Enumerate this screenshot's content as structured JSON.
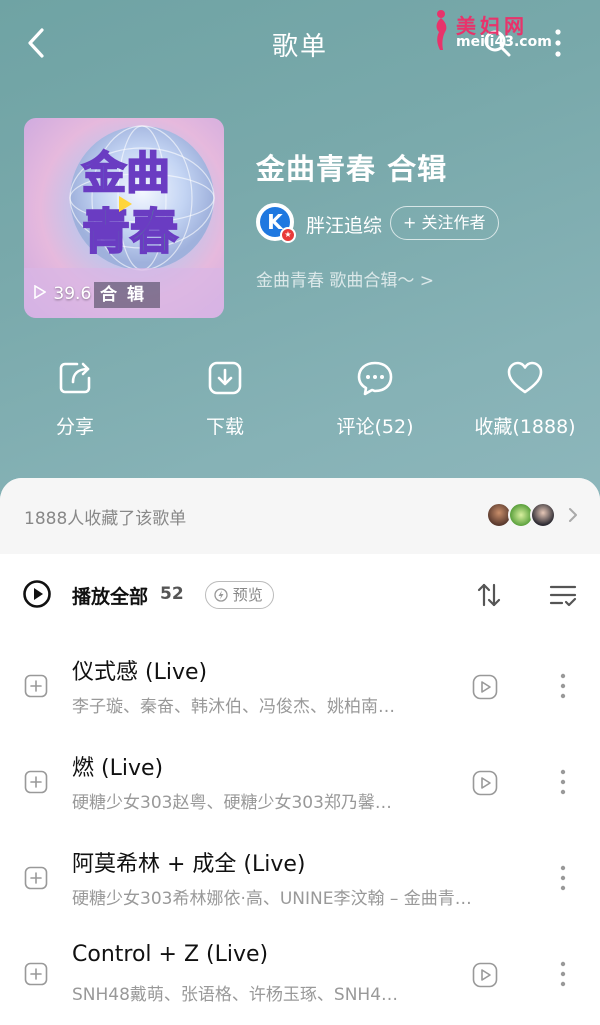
{
  "header": {
    "title": "歌单"
  },
  "watermark": {
    "title": "美妇网",
    "url": "meili43.com"
  },
  "playlist": {
    "cover_play_count": "39.6",
    "cover_tag": "合辑",
    "title": "金曲青春 合辑",
    "creator": "胖汪追综",
    "creator_avatar_letter": "K",
    "follow_label": "+ 关注作者",
    "description": "金曲青春 歌曲合辑～ >"
  },
  "actions": [
    {
      "label": "分享",
      "icon": "share-icon"
    },
    {
      "label": "下载",
      "icon": "download-icon"
    },
    {
      "label": "评论(52)",
      "icon": "comment-icon"
    },
    {
      "label": "收藏(1888)",
      "icon": "heart-icon"
    }
  ],
  "favorites": {
    "text": "1888人收藏了该歌单"
  },
  "play_all": {
    "label": "播放全部",
    "count": "52",
    "preview_label": "预览"
  },
  "songs": [
    {
      "name": "仪式感 (Live)",
      "artist": "李子璇、秦奋、韩沐伯、冯俊杰、姚柏南…"
    },
    {
      "name": "燃 (Live)",
      "artist": "硬糖少女303赵粤、硬糖少女303郑乃馨…"
    },
    {
      "name": "阿莫希林 + 成全 (Live)",
      "artist": "硬糖少女303希林娜依·高、UNINE李汶翰 – 金曲青…"
    },
    {
      "name": "Control + Z (Live)",
      "artist": "SNH48戴萌、张语格、许杨玉琢、SNH4…"
    }
  ],
  "colors": {
    "hero_top": "#6fa3a4",
    "hero_bottom": "#8fb8bd",
    "creator_blue": "#1f78e0",
    "badge_red": "#e83a3a",
    "watermark_pink": "#e8336b"
  }
}
